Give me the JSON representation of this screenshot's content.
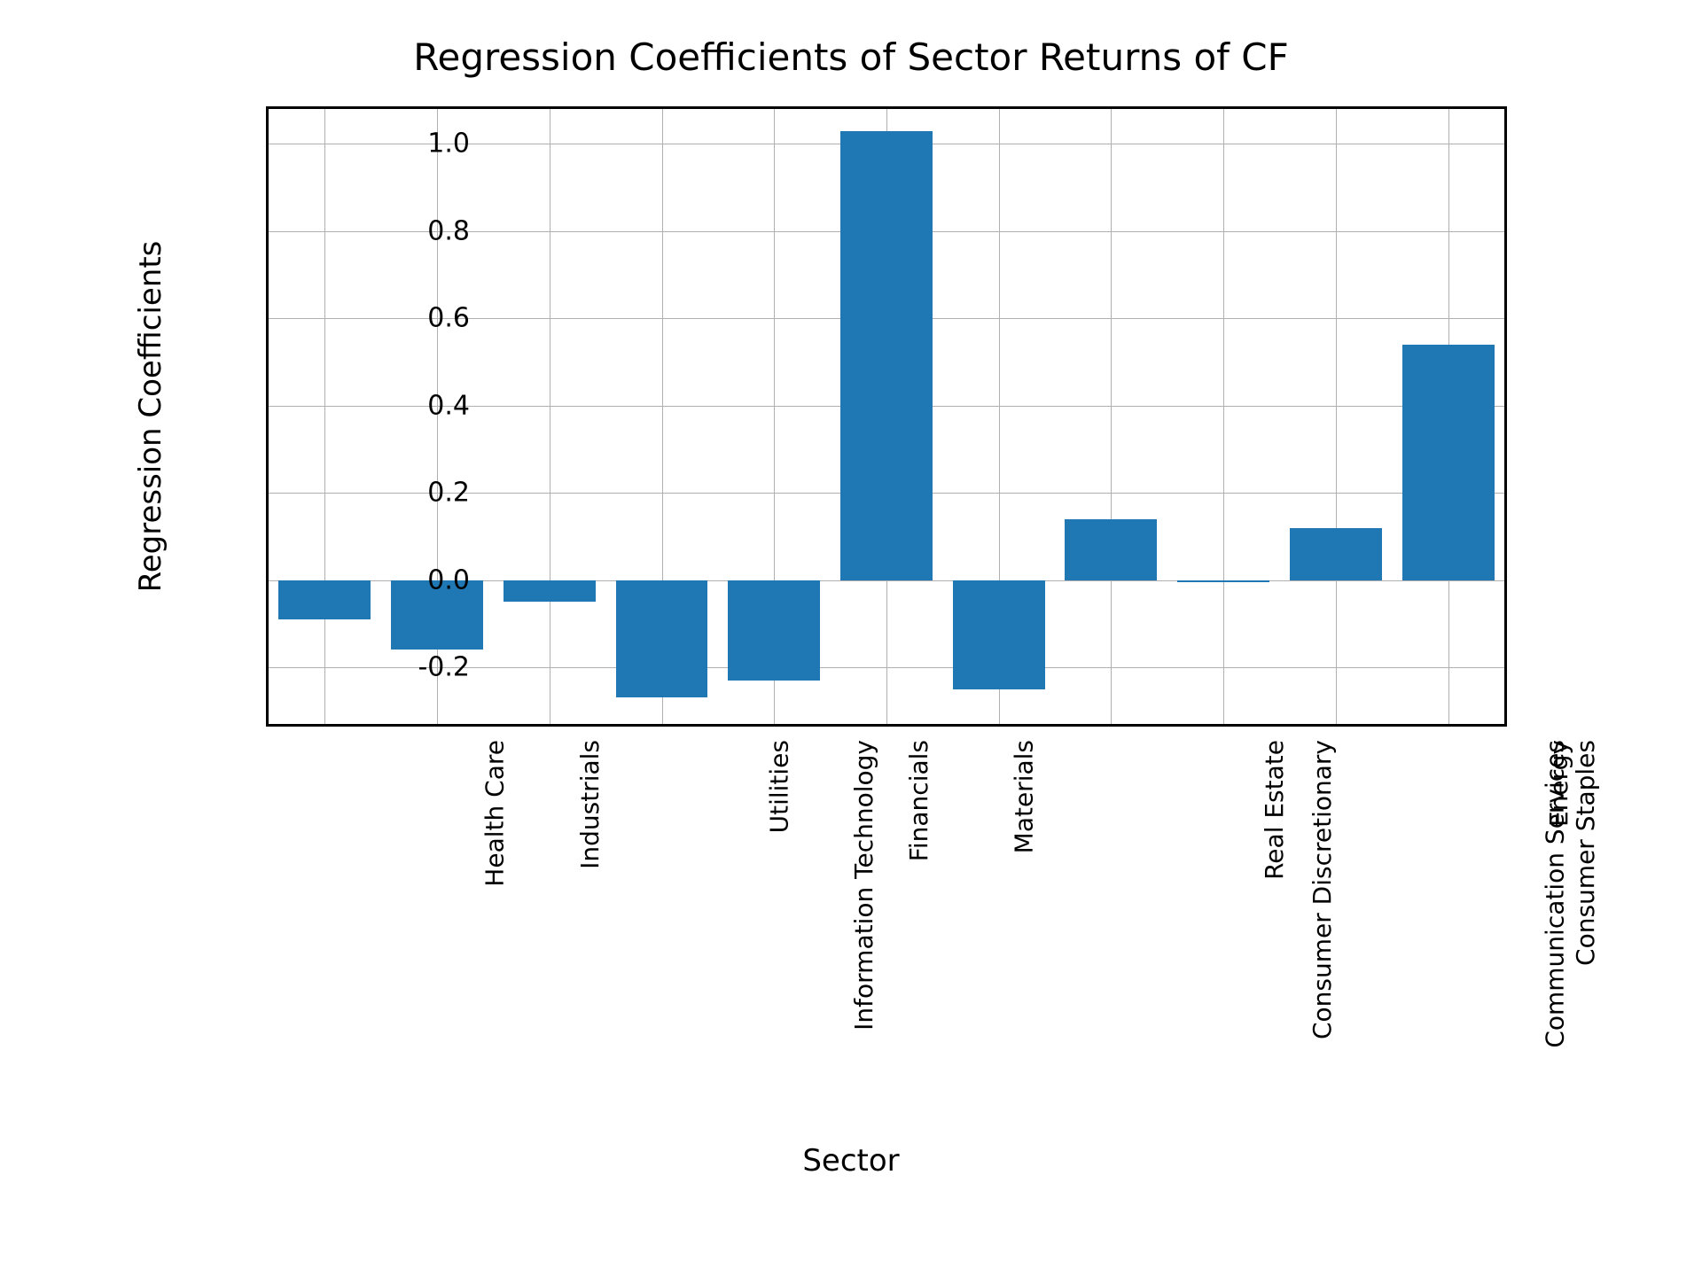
{
  "chart_data": {
    "type": "bar",
    "title": "Regression Coefficients of Sector Returns of CF",
    "xlabel": "Sector",
    "ylabel": "Regression Coefficients",
    "categories": [
      "Health Care",
      "Industrials",
      "Information Technology",
      "Utilities",
      "Financials",
      "Materials",
      "Consumer Discretionary",
      "Real Estate",
      "Communication Services",
      "Consumer Staples",
      "Energy"
    ],
    "values": [
      -0.09,
      -0.16,
      -0.05,
      -0.27,
      -0.23,
      1.03,
      -0.25,
      0.14,
      -0.005,
      0.12,
      0.54
    ],
    "ylim": [
      -0.33,
      1.08
    ],
    "yticks": [
      -0.2,
      0.0,
      0.2,
      0.4,
      0.6,
      0.8,
      1.0
    ],
    "bar_color": "#1f77b4"
  }
}
